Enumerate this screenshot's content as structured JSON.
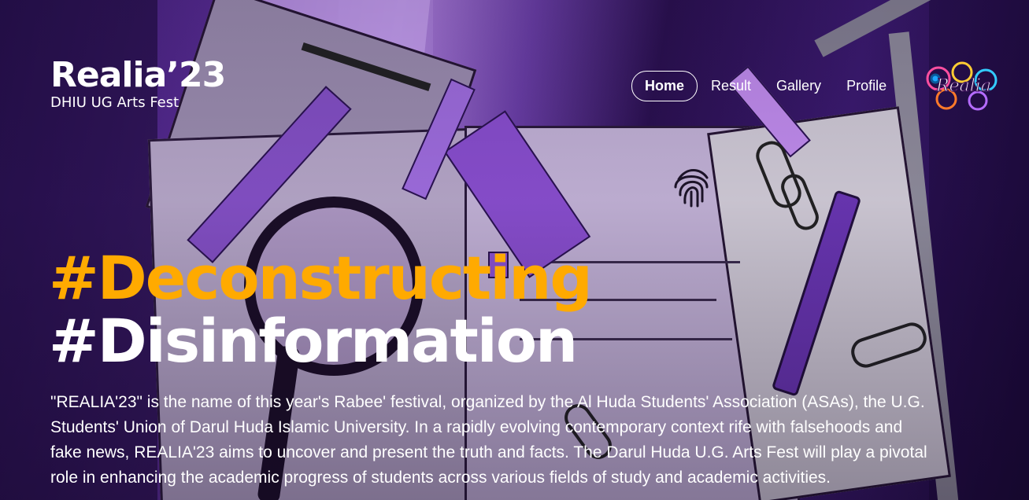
{
  "brand": {
    "title": "Realia’23",
    "subtitle": "DHIU UG Arts Fest"
  },
  "nav": {
    "home": "Home",
    "result": "Result",
    "gallery": "Gallery",
    "profile": "Profile"
  },
  "logo": {
    "text": "Realia"
  },
  "hero": {
    "line1": "#Deconstructing",
    "line2": "#Disinformation",
    "description": "\"REALIA'23\" is the name of this year's Rabee' festival, organized by the Al Huda Students' Association (ASAs), the U.G. Students' Union of Darul Huda Islamic University. In a rapidly evolving contemporary context rife with falsehoods and fake news, REALIA'23 aims to uncover and present the truth and facts. The Darul Huda U.G. Arts Fest will play a pivotal role in enhancing the academic progress of students across various fields of study and academic activities."
  },
  "colors": {
    "accent": "#ffaa00",
    "text": "#ffffff",
    "background": "#3a1b6e"
  }
}
